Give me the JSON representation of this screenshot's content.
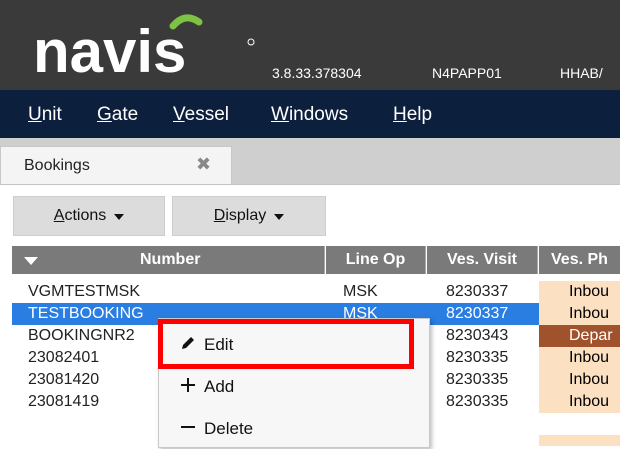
{
  "header": {
    "logo_text": "navis",
    "version": "3.8.33.378304",
    "server": "N4PAPP01",
    "facility": "HHAB/"
  },
  "menu": [
    {
      "label": "Unit",
      "underline": "U",
      "rest": "nit"
    },
    {
      "label": "Gate",
      "underline": "G",
      "rest": "ate"
    },
    {
      "label": "Vessel",
      "underline": "V",
      "rest": "essel"
    },
    {
      "label": "Windows",
      "underline": "W",
      "rest": "indows"
    },
    {
      "label": "Help",
      "underline": "H",
      "rest": "elp"
    }
  ],
  "tab": {
    "label": "Bookings",
    "close_glyph": "✖"
  },
  "toolbar": {
    "actions_prefix": "A",
    "actions_rest": "ctions",
    "display_prefix": "D",
    "display_rest": "isplay"
  },
  "table": {
    "columns": [
      "Number",
      "Line Op",
      "Ves. Visit",
      "Ves. Ph"
    ],
    "rows": [
      {
        "number": "VGMTESTMSK",
        "line_op": "MSK",
        "ves_visit": "8230337",
        "ves_phase": "Inbou"
      },
      {
        "number": "TESTBOOKING",
        "line_op": "MSK",
        "ves_visit": "8230337",
        "ves_phase": "Inbou",
        "selected": true
      },
      {
        "number": "BOOKINGNR2",
        "line_op": "",
        "ves_visit": "8230343",
        "ves_phase": "Depar"
      },
      {
        "number": "23082401",
        "line_op": "",
        "ves_visit": "8230335",
        "ves_phase": "Inbou"
      },
      {
        "number": "23081420",
        "line_op": "",
        "ves_visit": "8230335",
        "ves_phase": "Inbou"
      },
      {
        "number": "23081419",
        "line_op": "",
        "ves_visit": "8230335",
        "ves_phase": "Inbou"
      }
    ]
  },
  "context_menu": {
    "edit": "Edit",
    "add": "Add",
    "delete": "Delete"
  },
  "colors": {
    "header_bg": "#3a3a3a",
    "menubar_bg": "#0c1f3d",
    "logo_green": "#7dc242",
    "selected_row": "#2a7de1",
    "inbound_bg": "#fbe0c2",
    "departed_bg": "#a0522d",
    "highlight": "#ff0000"
  }
}
